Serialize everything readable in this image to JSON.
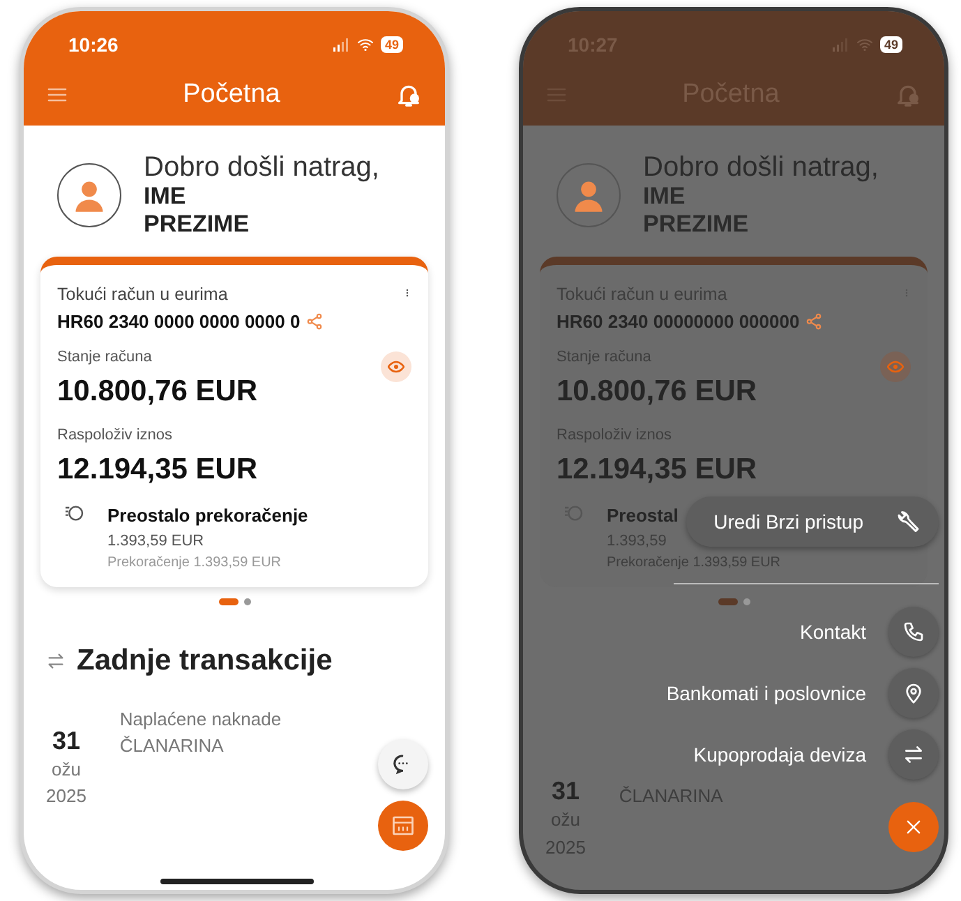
{
  "phones": [
    {
      "dimmed": false,
      "status": {
        "time": "10:26",
        "battery": "49"
      },
      "header": {
        "title": "Početna"
      },
      "welcome": {
        "greeting": "Dobro došli natrag,",
        "name_lines": [
          "IME",
          "PREZIME"
        ]
      },
      "account": {
        "type": "Tokući račun u eurima",
        "iban": "HR60 2340 0000 0000 0000 0",
        "balance_label": "Stanje računa",
        "balance": "10.800,76  EUR",
        "available_label": "Raspoloživ iznos",
        "available": "12.194,35  EUR",
        "overdraft_title": "Preostalo prekoračenje",
        "overdraft_amount": "1.393,59 EUR",
        "overdraft_limit": "Prekoračenje 1.393,59 EUR"
      },
      "pager": [
        {
          "selected": true
        },
        {
          "selected": false
        }
      ],
      "section_title": "Zadnje transakcije",
      "transactions": [
        {
          "day": "31",
          "month": "ožu",
          "year": "2025",
          "title": "Naplaćene naknade",
          "subtitle": "ČLANARINA"
        }
      ],
      "quick_menu": {
        "open": false
      }
    },
    {
      "dimmed": true,
      "status": {
        "time": "10:27",
        "battery": "49"
      },
      "header": {
        "title": "Početna"
      },
      "welcome": {
        "greeting": "Dobro došli natrag,",
        "name_lines": [
          "IME",
          "PREZIME"
        ]
      },
      "account": {
        "type": "Tokući račun u eurima",
        "iban": "HR60 2340 00000000 000000",
        "balance_label": "Stanje računa",
        "balance": "10.800,76  EUR",
        "available_label": "Raspoloživ iznos",
        "available": "12.194,35  EUR",
        "overdraft_title": "Preostal",
        "overdraft_amount": "1.393,59",
        "overdraft_limit": "Prekoračenje 1.393,59 EUR"
      },
      "pager": [
        {
          "selected": true
        },
        {
          "selected": false
        }
      ],
      "transactions": [
        {
          "day": "31",
          "month": "ožu",
          "year": "2025",
          "subtitle": "ČLANARINA"
        }
      ],
      "quick_menu": {
        "open": true,
        "items": [
          {
            "kind": "pill",
            "label": "Uredi Brzi pristup"
          },
          {
            "kind": "row",
            "label": "Kontakt"
          },
          {
            "kind": "row",
            "label": "Bankomati i poslovnice"
          },
          {
            "kind": "row",
            "label": "Kupoprodaja deviza"
          }
        ]
      }
    }
  ]
}
